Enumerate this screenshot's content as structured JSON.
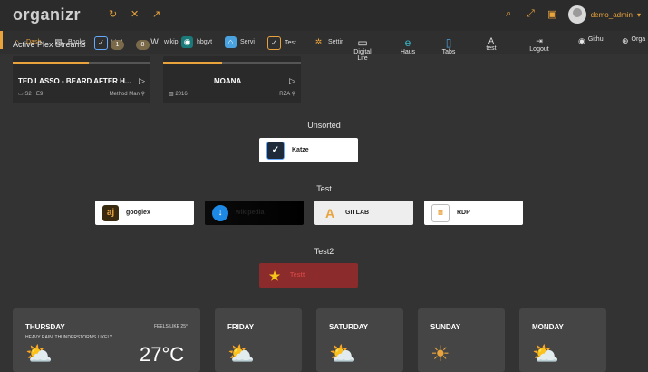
{
  "app": {
    "logo": "organizr"
  },
  "user": {
    "name": "demo_admin"
  },
  "tabs": [
    {
      "label": "Dash",
      "icon": "home-icon"
    },
    {
      "label": "Books",
      "icon": "book-icon"
    },
    {
      "label": "bitcl",
      "icon": "vpn-icon"
    },
    {
      "label": "wikip",
      "icon": "wiki-icon"
    },
    {
      "label": "hbgyt",
      "icon": "robot-icon"
    },
    {
      "label": "Servi",
      "icon": "house-icon"
    },
    {
      "label": "Test",
      "icon": "vpn-icon"
    },
    {
      "label": "Settir",
      "icon": "gear-icon"
    }
  ],
  "badges": [
    "1",
    "8"
  ],
  "right_nav": [
    {
      "label": "Digital Life",
      "icon": "monitor-icon"
    },
    {
      "label": "Haus",
      "icon": "edge-icon"
    },
    {
      "label": "Tabs",
      "icon": "phone-icon"
    },
    {
      "label": "test",
      "icon": "letter-a-icon"
    },
    {
      "label": "Logout",
      "icon": "logout-icon"
    },
    {
      "label": "Githu",
      "icon": "github-icon"
    },
    {
      "label": "Orga",
      "icon": "globe-icon"
    }
  ],
  "streams_title": "Active Plex Streams",
  "streams": [
    {
      "title": "TED LASSO - BEARD AFTER H...",
      "sub": "S2 · E9",
      "user": "Method Man",
      "progress": 0.55
    },
    {
      "title": "MOANA",
      "sub": "2016",
      "user": "RZA",
      "progress": 0.43
    }
  ],
  "groups": [
    {
      "title": "Unsorted",
      "tiles": [
        {
          "label": "Katze",
          "bg": "#ffffff",
          "icon": "vpn-icon"
        }
      ]
    },
    {
      "title": "Test",
      "tiles": [
        {
          "label": "googlex",
          "bg": "#ffffff",
          "icon": "aj-icon"
        },
        {
          "label": "wikipedia",
          "bg": "#000000",
          "icon": "download-icon"
        },
        {
          "label": "GITLAB",
          "bg": "#eeeeee",
          "icon": "letter-a-icon"
        },
        {
          "label": "RDP",
          "bg": "#ffffff",
          "icon": "broken-image-icon"
        }
      ]
    },
    {
      "title": "Test2",
      "tiles": [
        {
          "label": "Testt",
          "bg": "#8b2b2b",
          "icon": "star-icon"
        }
      ]
    }
  ],
  "weather": {
    "today": {
      "day": "THURSDAY",
      "feels": "FEELS LIKE 25°",
      "desc": "HEAVY RAIN. THUNDERSTORMS LIKELY",
      "temp": "27°C"
    },
    "forecast": [
      "FRIDAY",
      "SATURDAY",
      "SUNDAY",
      "MONDAY"
    ]
  }
}
